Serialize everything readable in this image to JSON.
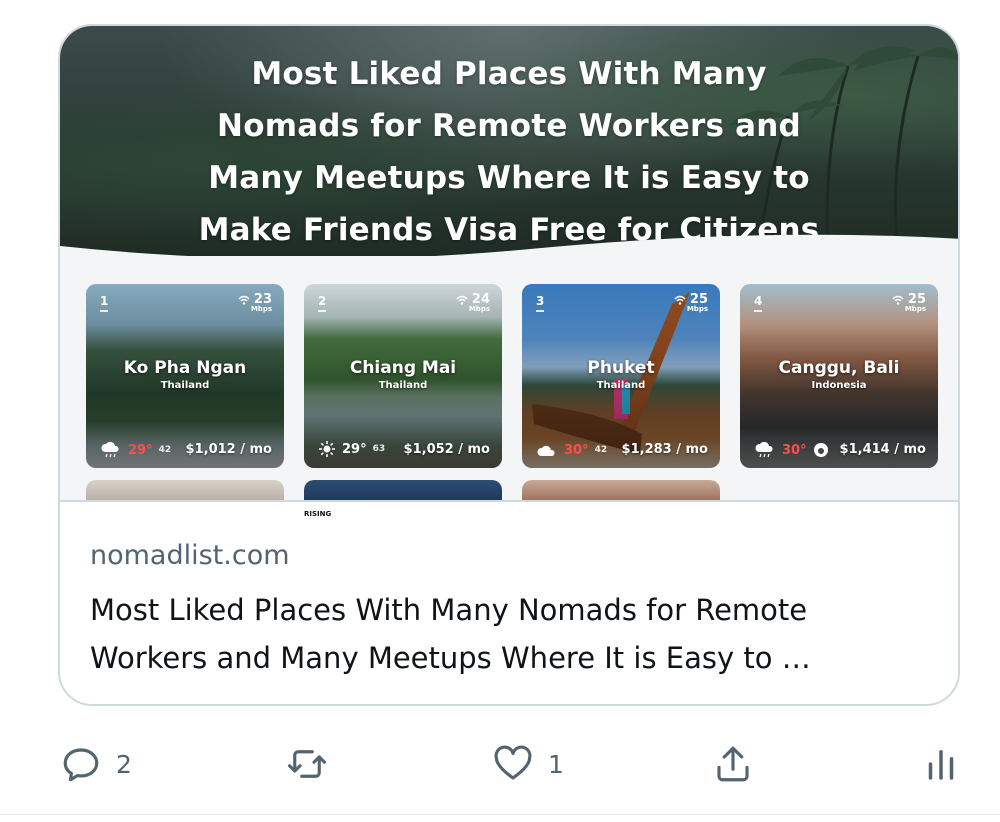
{
  "link_card": {
    "banner_title": "Most Liked Places With Many Nomads for Remote Workers and Many Meetups Where It is Easy to Make Friends Visa Free for Citizens of",
    "domain": "nomadlist.com",
    "description": "Most Liked Places With Many Nomads for Remote Workers and Many Meetups Where It is Easy to …",
    "rising_badge": "RISING",
    "places": [
      {
        "rank": "1",
        "wifi": "23",
        "wifi_unit": "Mbps",
        "city": "Ko Pha Ngan",
        "country": "Thailand",
        "temp": "29°",
        "aqi": "42",
        "price": "$1,012 / mo",
        "weather_icon": "rain-icon",
        "temp_color": "#ff4d4d"
      },
      {
        "rank": "2",
        "wifi": "24",
        "wifi_unit": "Mbps",
        "city": "Chiang Mai",
        "country": "Thailand",
        "temp": "29°",
        "aqi": "63",
        "price": "$1,052 / mo",
        "weather_icon": "sun-icon",
        "temp_color": "#ffffff"
      },
      {
        "rank": "3",
        "wifi": "25",
        "wifi_unit": "Mbps",
        "city": "Phuket",
        "country": "Thailand",
        "temp": "30°",
        "aqi": "42",
        "price": "$1,283 / mo",
        "weather_icon": "cloud-icon",
        "temp_color": "#ff4d4d"
      },
      {
        "rank": "4",
        "wifi": "25",
        "wifi_unit": "Mbps",
        "city": "Canggu, Bali",
        "country": "Indonesia",
        "temp": "30°",
        "aqi": "",
        "price": "$1,414 / mo",
        "weather_icon": "rain-icon",
        "temp_color": "#ff4d4d"
      }
    ]
  },
  "actions": {
    "reply_count": "2",
    "retweet_count": "",
    "like_count": "1"
  },
  "colors": {
    "secondary_text": "#536471",
    "card_border": "#cfd9de",
    "hot_temp": "#ff4d4d"
  }
}
